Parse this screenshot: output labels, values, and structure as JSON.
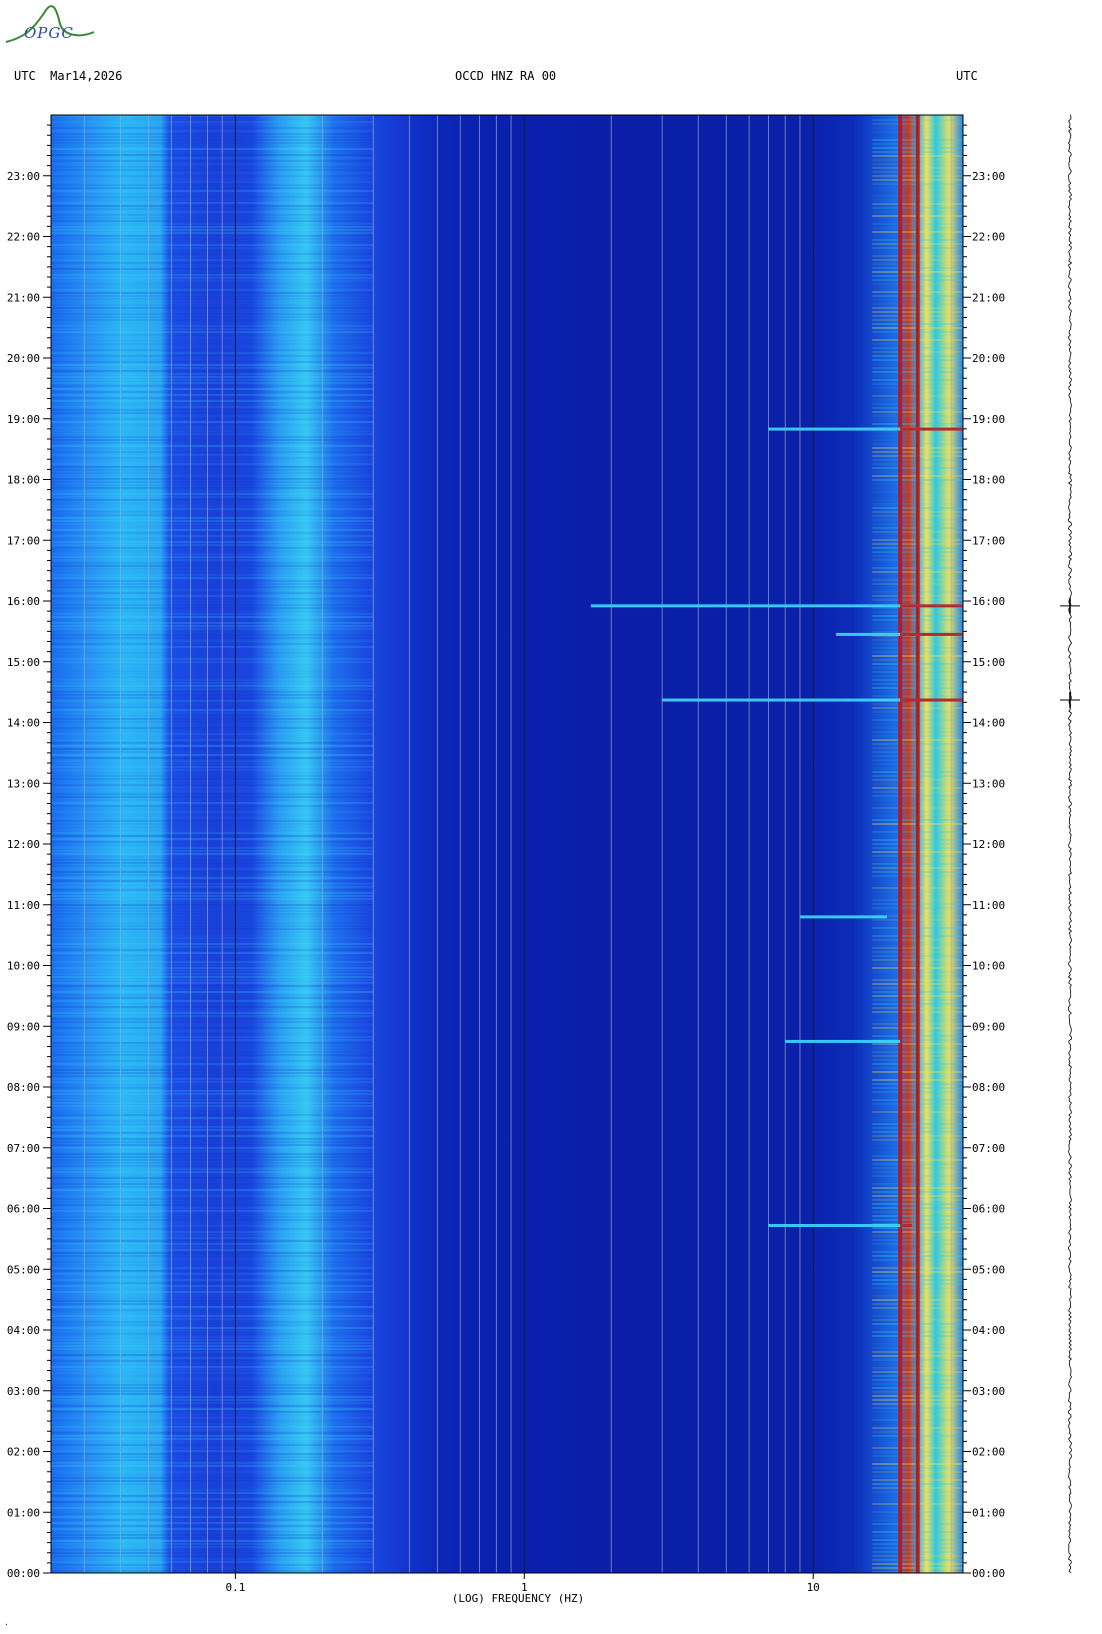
{
  "logo": {
    "text": "OPGC"
  },
  "header": {
    "left": "UTC  Mar14,2026",
    "center": "OCCD HNZ RA 00",
    "right": "UTC"
  },
  "colors": {
    "background": "#0a20a8",
    "low_freq": "#2aa8f0",
    "band_01_02": "#36c6f2",
    "red_line": "#c01010",
    "hot": "#f2e060"
  },
  "chart_data": {
    "type": "heatmap",
    "title": "OCCD HNZ RA 00",
    "xlabel": "(LOG) FREQUENCY (HZ)",
    "ylabel": "",
    "x_scale": "log",
    "xlim": [
      0.023,
      33
    ],
    "ylim": [
      "00:00",
      "24:00"
    ],
    "x_ticks": [
      {
        "value": 0.1,
        "label": "0.1"
      },
      {
        "value": 1,
        "label": "1"
      },
      {
        "value": 10,
        "label": "10"
      }
    ],
    "y_ticks": [
      "00:00",
      "01:00",
      "02:00",
      "03:00",
      "04:00",
      "05:00",
      "06:00",
      "07:00",
      "08:00",
      "09:00",
      "10:00",
      "11:00",
      "12:00",
      "13:00",
      "14:00",
      "15:00",
      "16:00",
      "17:00",
      "18:00",
      "19:00",
      "20:00",
      "21:00",
      "22:00",
      "23:00"
    ],
    "gridlines_hz": [
      0.03,
      0.04,
      0.05,
      0.06,
      0.07,
      0.08,
      0.09,
      0.2,
      0.3,
      0.4,
      0.5,
      0.6,
      0.7,
      0.8,
      0.9,
      2,
      3,
      4,
      5,
      6,
      7,
      8,
      9,
      20,
      30
    ],
    "persistent_lines_hz": [
      20,
      23
    ],
    "horizontal_events": [
      {
        "time": 15.92,
        "fmin": 1.7,
        "fmax": 33
      },
      {
        "time": 14.37,
        "fmin": 3.0,
        "fmax": 33
      },
      {
        "time": 18.83,
        "fmin": 7.0,
        "fmax": 33
      },
      {
        "time": 8.75,
        "fmin": 8.0,
        "fmax": 20
      },
      {
        "time": 5.72,
        "fmin": 7.0,
        "fmax": 22
      },
      {
        "time": 15.45,
        "fmin": 12,
        "fmax": 33
      },
      {
        "time": 10.8,
        "fmin": 9,
        "fmax": 18
      }
    ],
    "trace_markers": [
      15.92,
      14.37
    ]
  }
}
